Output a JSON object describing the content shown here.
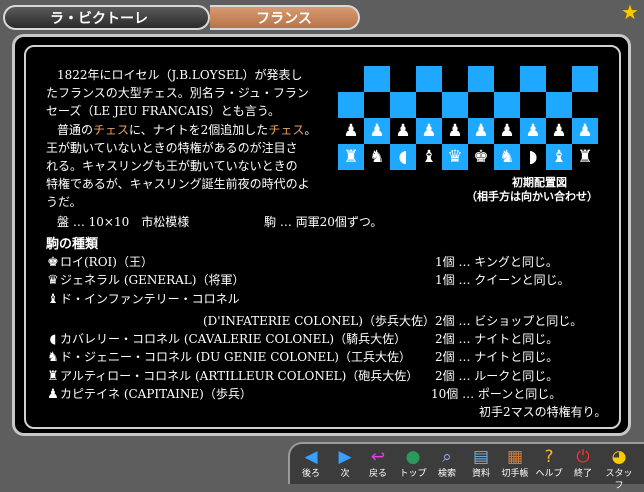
{
  "header": {
    "title": "ラ・ビクトーレ",
    "country": "フランス"
  },
  "description": {
    "line1": "1822年にロイセル（J.B.LOYSEL）が発表し",
    "line2": "たフランスの大型チェス。別名ラ・ジュ・フラン",
    "line3": "セーズ（LE JEU FRANCAIS）とも言う。",
    "line4_pre": "普通の",
    "line4_hl1": "チェス",
    "line4_mid": "に、ナイトを2個追加した",
    "line4_hl2": "チェス",
    "line4_post": "。",
    "line5": "王が動いていないときの特権があるのが注目さ",
    "line6": "れる。キャスリングも王が動いていないときの",
    "line7": "特権であるが、キャスリング誕生前夜の時代のよ",
    "line8": "うだ。",
    "board_info": "盤 … 10×10　市松模様",
    "pieces_info": "駒 … 両軍20個ずつ。"
  },
  "board": {
    "caption1": "初期配置図",
    "caption2": "（相手方は向かい合わせ）",
    "row3": [
      "♟",
      "♟",
      "♟",
      "♟",
      "♟",
      "♟",
      "♟",
      "♟",
      "♟",
      "♟"
    ],
    "row4": [
      "♜",
      "♞",
      "◖",
      "♝",
      "♛",
      "♚",
      "♞",
      "◗",
      "♝",
      "♜"
    ]
  },
  "pieces_heading": "駒の種類",
  "pieces": [
    {
      "icon": "♚",
      "name": "ロイ(ROI)（王）",
      "count": "1個 … キングと同じ。"
    },
    {
      "icon": "♛",
      "name": "ジェネラル (GENERAL)（将軍）",
      "count": "1個 … クイーンと同じ。"
    },
    {
      "icon": "♝",
      "name": "ド・インファンテリー・コロネル",
      "count": ""
    },
    {
      "icon": "",
      "name": "(D'INFATERIE COLONEL)（歩兵大佐）",
      "count": "2個 … ビショップと同じ。"
    },
    {
      "icon": "◖",
      "name": "カバレリー・コロネル (CAVALERIE COLONEL)（騎兵大佐）",
      "count": "2個 … ナイトと同じ。"
    },
    {
      "icon": "♞",
      "name": "ド・ジェニー・コロネル (DU GENIE COLONEL)（工兵大佐）",
      "count": "2個 … ナイトと同じ。"
    },
    {
      "icon": "♜",
      "name": "アルティロー・コロネル (ARTILLEUR COLONEL)（砲兵大佐）",
      "count": "2個 … ルークと同じ。"
    },
    {
      "icon": "♟",
      "name": "カピテイネ (CAPITAINE)（歩兵）",
      "count": "10個 … ポーンと同じ。"
    }
  ],
  "pawn_note": "初手2マスの特権有り。",
  "toolbar": [
    {
      "icon": "◀",
      "label": "後ろ",
      "color": "#3aa0ff",
      "name": "back-arrow-icon"
    },
    {
      "icon": "▶",
      "label": "次",
      "color": "#3aa0ff",
      "name": "next-arrow-icon"
    },
    {
      "icon": "↩",
      "label": "戻る",
      "color": "#e040e0",
      "name": "return-icon"
    },
    {
      "icon": "●",
      "label": "トップ",
      "color": "#2a9a5a",
      "name": "globe-icon"
    },
    {
      "icon": "⌕",
      "label": "検索",
      "color": "#9ab4ff",
      "name": "search-icon"
    },
    {
      "icon": "▤",
      "label": "資料",
      "color": "#7ab0e0",
      "name": "book-icon"
    },
    {
      "icon": "▦",
      "label": "切手帳",
      "color": "#d08040",
      "name": "stamp-icon"
    },
    {
      "icon": "?",
      "label": "ヘルプ",
      "color": "#ffb020",
      "name": "help-icon"
    },
    {
      "icon": "⏻",
      "label": "終了",
      "color": "#ff3030",
      "name": "power-icon"
    },
    {
      "icon": "◕",
      "label": "スタッフ",
      "color": "#ffcc00",
      "name": "staff-icon"
    }
  ]
}
